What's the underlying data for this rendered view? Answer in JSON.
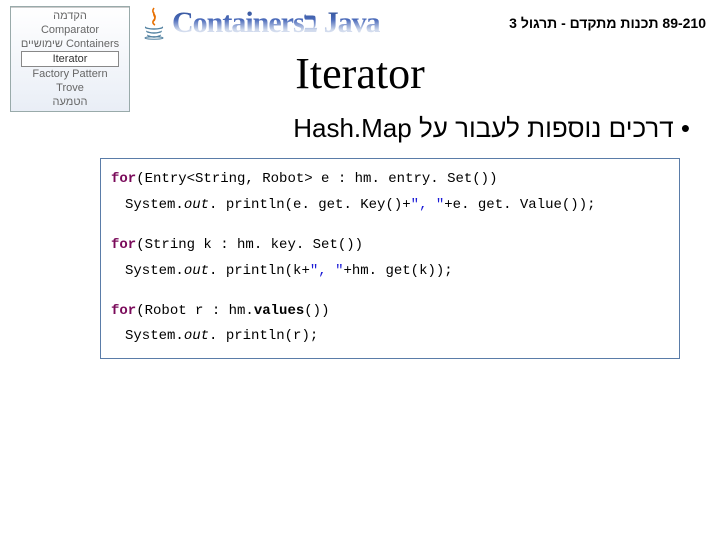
{
  "header": {
    "title_wordart": "Containersב Java",
    "course_label": "89-210 תכנות מתקדם - תרגול 3"
  },
  "nav": {
    "items": [
      "הקדמה",
      "Comparator",
      "שימושיים Containers",
      "Iterator",
      "Factory Pattern",
      "Trove",
      "הטמעה"
    ],
    "selected_index": 3
  },
  "slide": {
    "title": "Iterator",
    "bullet_hebrew": "דרכים נוספות לעבור על",
    "bullet_latin": "Hash.Map"
  },
  "code": {
    "l1_for": "for",
    "l1_a": "(Entry<String, Robot> e : hm. entry. Set())",
    "l2_a": "System.",
    "l2_out": "out",
    "l2_b": ". println(e. get. Key()+",
    "l2_str": "\", \"",
    "l2_c": "+e. get. Value());",
    "l3_for": "for",
    "l3_a": "(String k : hm. key. Set())",
    "l4_a": "System.",
    "l4_out": "out",
    "l4_b": ". println(k+",
    "l4_str": "\", \"",
    "l4_c": "+hm. get(k));",
    "l5_for": "for",
    "l5_a": "(Robot r : hm.",
    "l5_b": "values",
    "l5_c": "())",
    "l6_a": "System.",
    "l6_out": "out",
    "l6_b": ". println(r);"
  }
}
